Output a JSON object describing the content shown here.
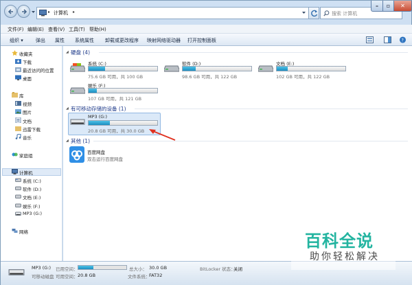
{
  "address": {
    "segments": [
      "计算机"
    ]
  },
  "search": {
    "placeholder": "搜索 计算机"
  },
  "menu": [
    "文件(F)",
    "编辑(E)",
    "查看(V)",
    "工具(T)",
    "帮助(H)"
  ],
  "toolbar": {
    "organize": "组织 ▾",
    "items": [
      "弹出",
      "属性",
      "系统属性",
      "卸载或更改程序",
      "映射网络驱动器",
      "打开控制面板"
    ]
  },
  "sidebar": {
    "favorites": {
      "label": "收藏夹",
      "items": [
        "下载",
        "最近访问的位置",
        "桌面"
      ]
    },
    "libraries": {
      "label": "库",
      "items": [
        "视频",
        "图片",
        "文档",
        "迅雷下载",
        "音乐"
      ]
    },
    "homegroup": "家庭组",
    "computer": {
      "label": "计算机",
      "items": [
        "系统 (C:)",
        "软件 (D:)",
        "文档 (E:)",
        "娱乐 (F:)",
        "MP3 (G:)"
      ]
    },
    "network": "网络"
  },
  "groups": {
    "hdd": "硬盘 (4)",
    "removable": "有可移动存储的设备 (1)",
    "other": "其他 (1)"
  },
  "drives": [
    {
      "name": "系统 (C:)",
      "free": "75.6 GB 可用，共 100 GB",
      "used_fraction": 0.24
    },
    {
      "name": "软件 (D:)",
      "free": "98.6 GB 可用，共 122 GB",
      "used_fraction": 0.19
    },
    {
      "name": "文档 (E:)",
      "free": "102 GB 可用，共 122 GB",
      "used_fraction": 0.16
    },
    {
      "name": "娱乐 (F:)",
      "free": "107 GB 可用，共 121 GB",
      "used_fraction": 0.12
    }
  ],
  "removable": {
    "name": "MP3 (G:)",
    "free": "20.8 GB 可用，共 30.0 GB",
    "used_fraction": 0.31
  },
  "other": {
    "name": "百度网盘",
    "desc": "双击运行百度网盘"
  },
  "status": {
    "name": "MP3 (G:)",
    "type": "可移动磁盘",
    "used_label": "已用空间：",
    "free_label": "可用空间：",
    "free_value": "20.8 GB",
    "total_label": "总大小：",
    "total_value": "30.0 GB",
    "fs_label": "文件系统：",
    "fs_value": "FAT32",
    "bitlocker_label": "BitLocker 状态：",
    "bitlocker_value": "关闭",
    "used_fraction": 0.31
  },
  "watermark": {
    "title": "百科全说",
    "subtitle": "助你轻松解决"
  },
  "colors": {
    "accent": "#1d8ec1",
    "group": "#1e3a8a",
    "watermark": "#23b4a0"
  }
}
